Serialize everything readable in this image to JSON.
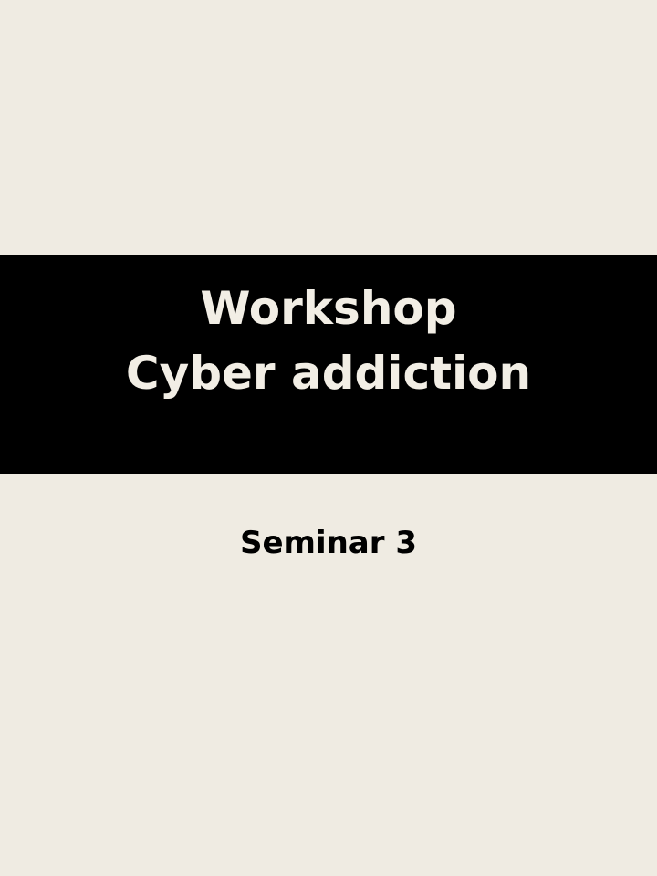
{
  "slide": {
    "background_color": "#EFEBE2",
    "band_color": "#000000",
    "title_color": "#F2EEE5",
    "subtitle_color": "#000000"
  },
  "title": {
    "line1": "Workshop",
    "line2": "Cyber addiction"
  },
  "subtitle": "Seminar 3"
}
